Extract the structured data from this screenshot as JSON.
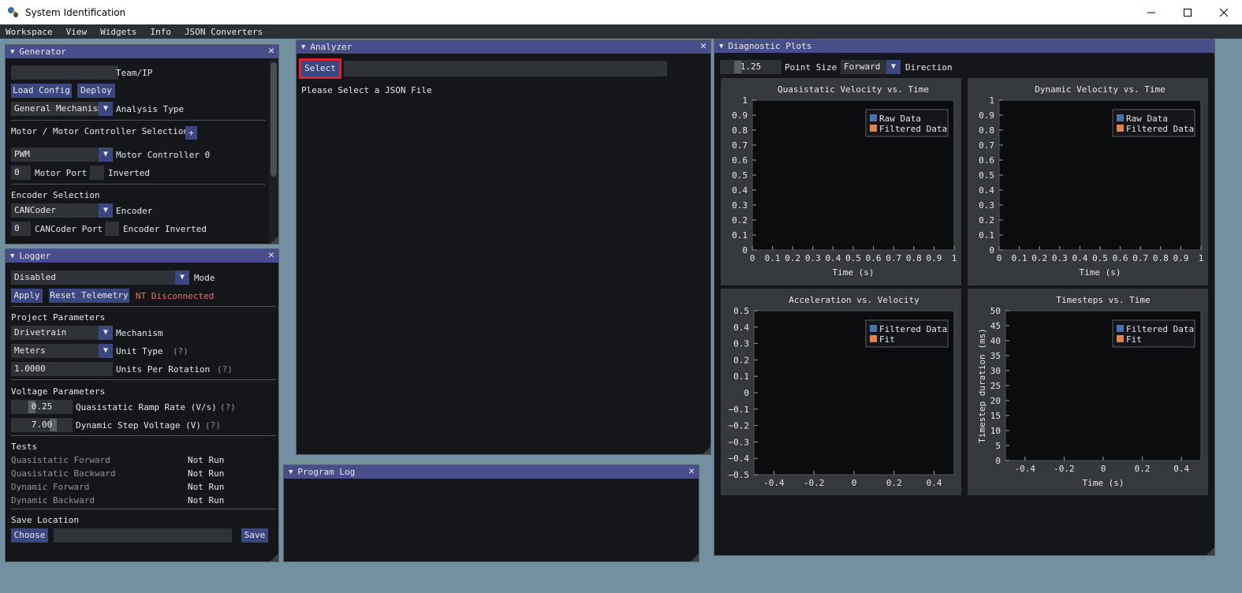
{
  "window": {
    "title": "System Identification",
    "icon": "robot-app-icon"
  },
  "menubar": {
    "items": [
      "Workspace",
      "View",
      "Widgets",
      "Info",
      "JSON Converters"
    ]
  },
  "generator": {
    "title": "Generator",
    "team_ip_value": "",
    "team_ip_label": "Team/IP",
    "load_config": "Load Config",
    "deploy": "Deploy",
    "analysis_type_value": "General Mechanism",
    "analysis_type_label": "Analysis Type",
    "motor_section": "Motor / Motor Controller Selection",
    "add_button": "+",
    "motor_controller_value": "PWM",
    "motor_controller_label": "Motor Controller 0",
    "motor_port_value": "0",
    "motor_port_label": "Motor Port",
    "inverted_label": "Inverted",
    "encoder_section": "Encoder Selection",
    "encoder_value": "CANCoder",
    "encoder_label": "Encoder",
    "cancoder_port_value": "0",
    "cancoder_port_label": "CANCoder Port",
    "encoder_inverted_label": "Encoder Inverted"
  },
  "logger": {
    "title": "Logger",
    "mode_value": "Disabled",
    "mode_label": "Mode",
    "apply": "Apply",
    "reset_telemetry": "Reset Telemetry",
    "nt_status": "NT Disconnected",
    "project_section": "Project Parameters",
    "mechanism_value": "Drivetrain",
    "mechanism_label": "Mechanism",
    "unit_type_value": "Meters",
    "unit_type_label": "Unit Type",
    "help": "(?)",
    "units_per_rotation_value": "1.0000",
    "units_per_rotation_label": "Units Per Rotation",
    "voltage_section": "Voltage Parameters",
    "quasistatic_ramp_value": "0.25",
    "quasistatic_ramp_label": "Quasistatic Ramp Rate (V/s)",
    "dynamic_step_value": "7.00",
    "dynamic_step_label": "Dynamic Step Voltage (V)",
    "tests_section": "Tests",
    "tests": [
      {
        "name": "Quasistatic Forward",
        "status": "Not Run"
      },
      {
        "name": "Quasistatic Backward",
        "status": "Not Run"
      },
      {
        "name": "Dynamic Forward",
        "status": "Not Run"
      },
      {
        "name": "Dynamic Backward",
        "status": "Not Run"
      }
    ],
    "save_section": "Save Location",
    "choose": "Choose",
    "save_path_value": "",
    "save": "Save"
  },
  "analyzer": {
    "title": "Analyzer",
    "select": "Select",
    "path_value": "",
    "message": "Please Select a JSON File"
  },
  "program_log": {
    "title": "Program Log"
  },
  "diagnostic": {
    "title": "Diagnostic Plots",
    "point_size_value": "1.25",
    "point_size_label": "Point Size",
    "direction_value": "Forward",
    "direction_label": "Direction",
    "colors": {
      "blue": "#4a72b0",
      "orange": "#dd8452"
    }
  },
  "chart_data": [
    {
      "type": "scatter",
      "title": "Quasistatic Velocity vs. Time",
      "xlabel": "Time (s)",
      "ylabel": "",
      "xlim": [
        0,
        1
      ],
      "ylim": [
        0,
        1
      ],
      "xticks": [
        "0",
        "0.1",
        "0.2",
        "0.3",
        "0.4",
        "0.5",
        "0.6",
        "0.7",
        "0.8",
        "0.9",
        "1"
      ],
      "yticks": [
        "0",
        "0.1",
        "0.2",
        "0.3",
        "0.4",
        "0.5",
        "0.6",
        "0.7",
        "0.8",
        "0.9",
        "1"
      ],
      "legend": [
        "Raw Data",
        "Filtered Data"
      ],
      "legend_colors": [
        "#4a72b0",
        "#dd8452"
      ],
      "legend_position": "top-right",
      "series": []
    },
    {
      "type": "scatter",
      "title": "Dynamic Velocity vs. Time",
      "xlabel": "Time (s)",
      "ylabel": "",
      "xlim": [
        0,
        1
      ],
      "ylim": [
        0,
        1
      ],
      "xticks": [
        "0",
        "0.1",
        "0.2",
        "0.3",
        "0.4",
        "0.5",
        "0.6",
        "0.7",
        "0.8",
        "0.9",
        "1"
      ],
      "yticks": [
        "0",
        "0.1",
        "0.2",
        "0.3",
        "0.4",
        "0.5",
        "0.6",
        "0.7",
        "0.8",
        "0.9",
        "1"
      ],
      "legend": [
        "Raw Data",
        "Filtered Data"
      ],
      "legend_colors": [
        "#4a72b0",
        "#dd8452"
      ],
      "legend_position": "top-right",
      "series": []
    },
    {
      "type": "scatter",
      "title": "Acceleration vs. Velocity",
      "xlabel": "",
      "ylabel": "",
      "xlim": [
        -0.5,
        0.5
      ],
      "ylim": [
        -0.5,
        0.5
      ],
      "xticks": [
        "-0.4",
        "-0.2",
        "0",
        "0.2",
        "0.4"
      ],
      "xtick_values": [
        -0.4,
        -0.2,
        0,
        0.2,
        0.4
      ],
      "yticks": [
        "−0.5",
        "−0.4",
        "−0.3",
        "−0.2",
        "−0.1",
        "0",
        "0.1",
        "0.2",
        "0.3",
        "0.4",
        "0.5"
      ],
      "legend": [
        "Filtered Data",
        "Fit"
      ],
      "legend_colors": [
        "#4a72b0",
        "#dd8452"
      ],
      "legend_position": "top-right",
      "series": []
    },
    {
      "type": "scatter",
      "title": "Timesteps vs. Time",
      "xlabel": "Time (s)",
      "ylabel": "Timestep duration (ms)",
      "xlim": [
        -0.5,
        0.5
      ],
      "ylim": [
        0,
        50
      ],
      "xticks": [
        "-0.4",
        "-0.2",
        "0",
        "0.2",
        "0.4"
      ],
      "xtick_values": [
        -0.4,
        -0.2,
        0,
        0.2,
        0.4
      ],
      "yticks": [
        "0",
        "5",
        "10",
        "15",
        "20",
        "25",
        "30",
        "35",
        "40",
        "45",
        "50"
      ],
      "legend": [
        "Filtered Data",
        "Fit"
      ],
      "legend_colors": [
        "#4a72b0",
        "#dd8452"
      ],
      "legend_position": "top-right",
      "series": []
    }
  ]
}
